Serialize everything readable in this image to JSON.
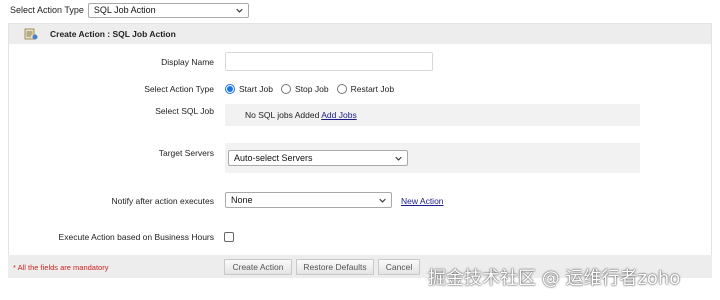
{
  "top": {
    "label": "Select Action Type",
    "selected": "SQL Job Action"
  },
  "header": {
    "title": "Create Action : SQL Job Action"
  },
  "form": {
    "display_name_label": "Display Name",
    "display_name_value": "",
    "action_type_label": "Select Action Type",
    "action_type_options": [
      "Start Job",
      "Stop Job",
      "Restart Job"
    ],
    "action_type_selected": "Start Job",
    "sql_job_label": "Select SQL Job",
    "sql_job_empty_text": "No SQL jobs Added",
    "sql_job_add_link": "Add Jobs",
    "target_servers_label": "Target Servers",
    "target_servers_selected": "Auto-select Servers",
    "notify_label": "Notify after action executes",
    "notify_selected": "None",
    "new_action_link": "New Action",
    "business_hours_label": "Execute Action based on Business Hours",
    "business_hours_checked": false
  },
  "footer": {
    "mandatory_note": "* All the fields are mandatory",
    "create_button": "Create Action",
    "restore_button": "Restore Defaults",
    "cancel_button": "Cancel"
  },
  "watermark": "掘金技术社区 @ 运维行者zoho",
  "colors": {
    "accent": "#1a73e8",
    "link": "#1a1a8c",
    "mandatory": "#d21f1f",
    "header_bg": "#ededed"
  }
}
